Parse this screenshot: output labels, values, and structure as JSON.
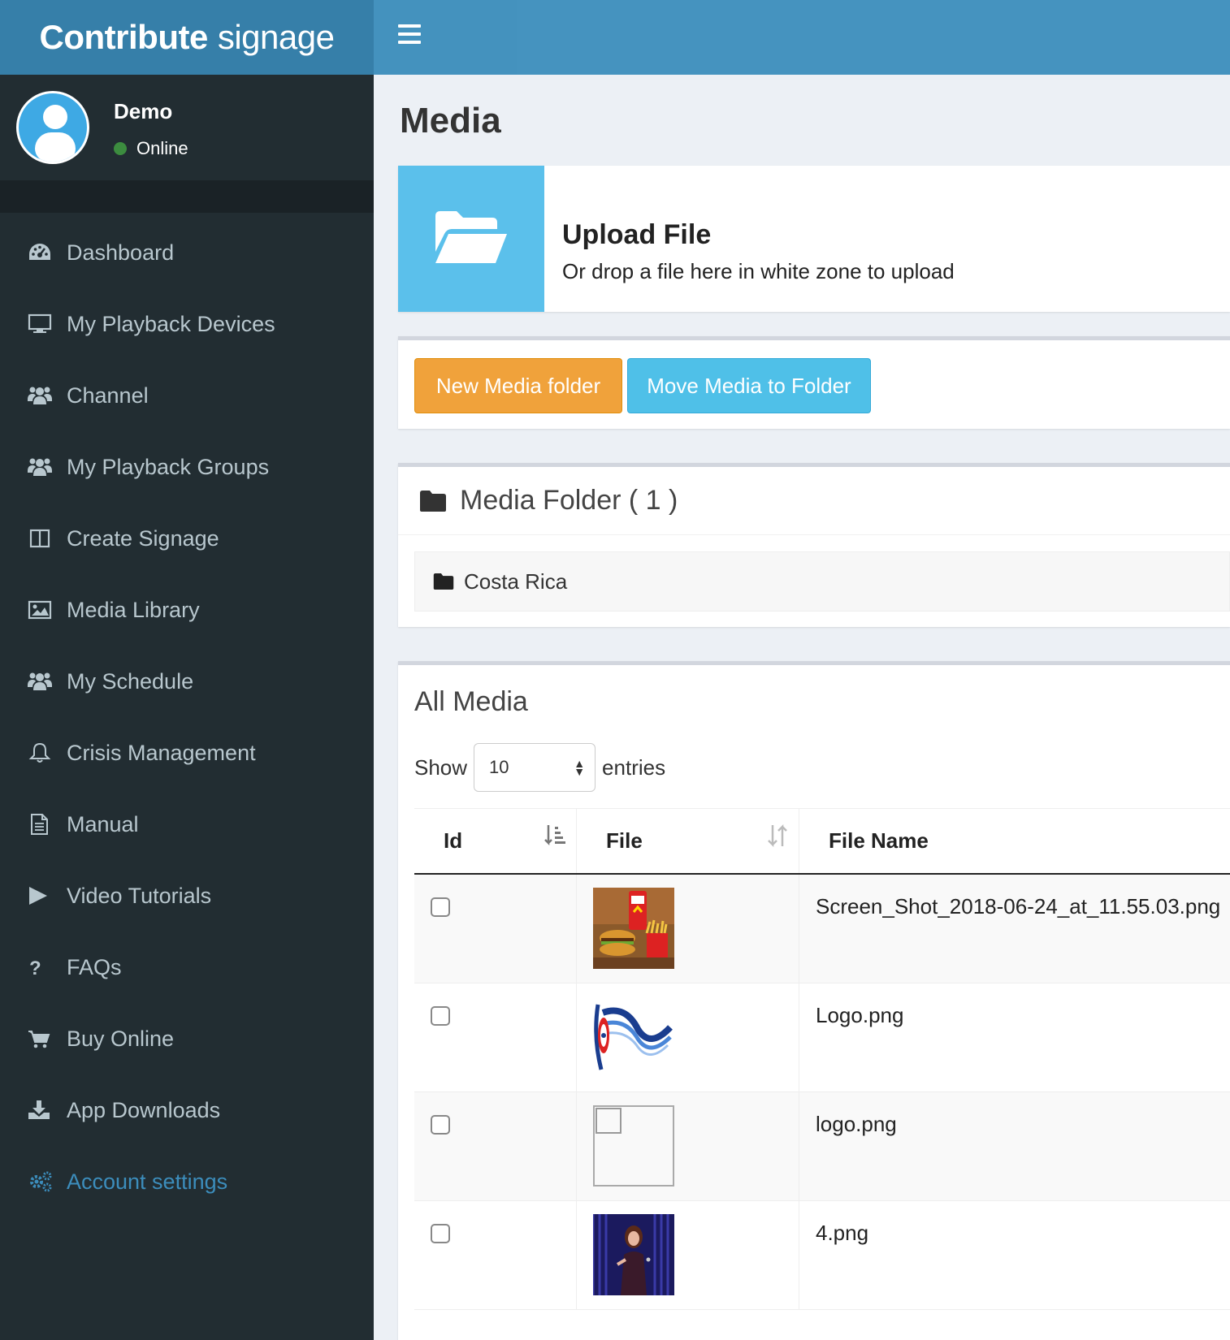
{
  "brand": {
    "bold": "Contribute",
    "light": "signage"
  },
  "user": {
    "name": "Demo",
    "status": "Online"
  },
  "nav": [
    {
      "label": "Dashboard",
      "icon": "dashboard-icon"
    },
    {
      "label": "My Playback Devices",
      "icon": "monitor-icon"
    },
    {
      "label": "Channel",
      "icon": "users-icon"
    },
    {
      "label": "My Playback Groups",
      "icon": "users-icon"
    },
    {
      "label": "Create Signage",
      "icon": "columns-icon"
    },
    {
      "label": "Media Library",
      "icon": "image-icon"
    },
    {
      "label": "My Schedule",
      "icon": "users-icon"
    },
    {
      "label": "Crisis Management",
      "icon": "bell-icon"
    },
    {
      "label": "Manual",
      "icon": "document-icon"
    },
    {
      "label": "Video Tutorials",
      "icon": "play-icon"
    },
    {
      "label": "FAQs",
      "icon": "question-icon"
    },
    {
      "label": "Buy Online",
      "icon": "cart-icon"
    },
    {
      "label": "App Downloads",
      "icon": "download-icon"
    },
    {
      "label": "Account settings",
      "icon": "gears-icon"
    }
  ],
  "page": {
    "title": "Media"
  },
  "upload": {
    "title": "Upload File",
    "subtitle": "Or drop a file here in white zone to upload"
  },
  "actions": {
    "new_folder": "New Media folder",
    "move_media": "Move Media to Folder"
  },
  "folders": {
    "heading": "Media Folder ( 1 )",
    "items": [
      "Costa Rica"
    ]
  },
  "media": {
    "heading": "All Media",
    "show_label": "Show",
    "entries_label": "entries",
    "page_size": "10",
    "columns": [
      "Id",
      "File",
      "File Name"
    ],
    "rows": [
      {
        "file_name": "Screen_Shot_2018-06-24_at_11.55.03.png",
        "thumb": "food-photo"
      },
      {
        "file_name": "Logo.png",
        "thumb": "flag-logo"
      },
      {
        "file_name": "logo.png",
        "thumb": "broken-image"
      },
      {
        "file_name": "4.png",
        "thumb": "performer-photo"
      }
    ]
  },
  "colors": {
    "sidebar": "#222d32",
    "header": "#3c8dbc",
    "warning": "#f0a23b",
    "info": "#4fc0e8",
    "upload_tile": "#5bc0eb"
  }
}
